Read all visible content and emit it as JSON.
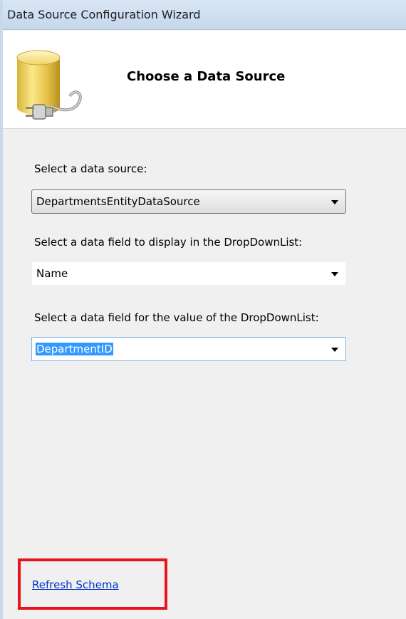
{
  "window": {
    "title": "Data Source Configuration Wizard"
  },
  "header": {
    "title": "Choose a Data Source",
    "icon": "database-plug-icon"
  },
  "form": {
    "data_source_label": "Select a data source:",
    "data_source_value": "DepartmentsEntityDataSource",
    "display_field_label": "Select a data field to display in the DropDownList:",
    "display_field_value": "Name",
    "value_field_label": "Select a data field for the value of the DropDownList:",
    "value_field_value": "DepartmentID"
  },
  "footer": {
    "refresh_link": "Refresh Schema"
  },
  "colors": {
    "highlight_box": "#e8141c",
    "link": "#0033cc",
    "selection": "#3399ff"
  }
}
